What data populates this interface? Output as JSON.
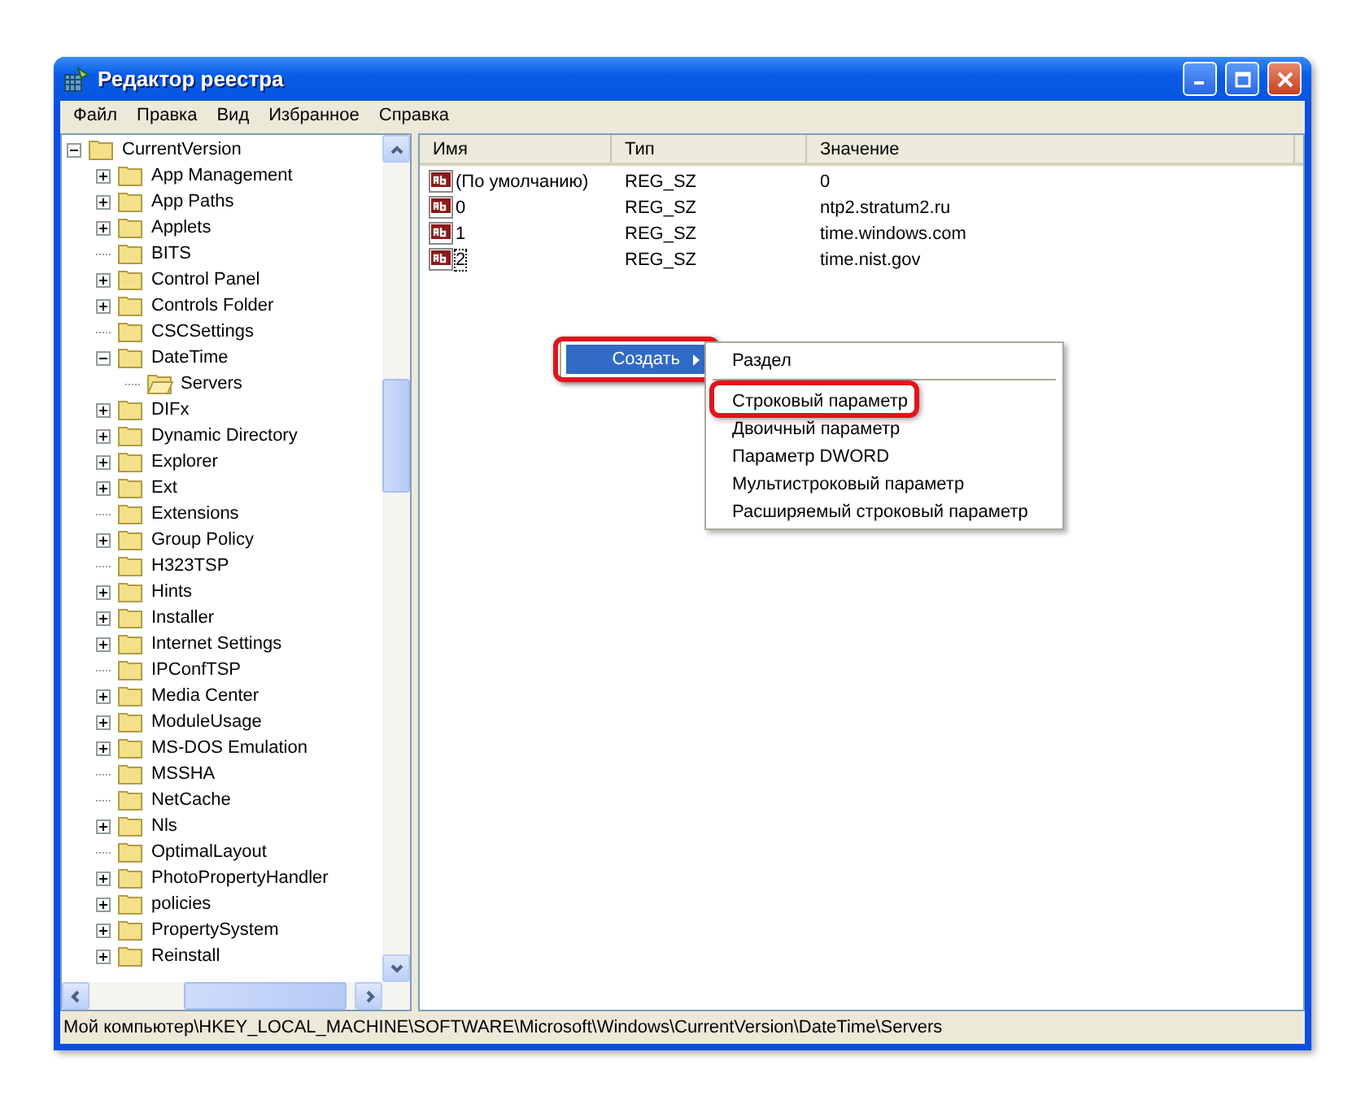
{
  "window": {
    "title": "Редактор реестра"
  },
  "menu_bar": [
    "Файл",
    "Правка",
    "Вид",
    "Избранное",
    "Справка"
  ],
  "tree": [
    {
      "label": "CurrentVersion",
      "kind": "node",
      "expanded": true,
      "selected": false,
      "children": [
        {
          "label": "App Management",
          "kind": "node",
          "expanded": false,
          "selected": false
        },
        {
          "label": "App Paths",
          "kind": "node",
          "expanded": false,
          "selected": false
        },
        {
          "label": "Applets",
          "kind": "node",
          "expanded": false,
          "selected": false
        },
        {
          "label": "BITS",
          "kind": "leaf",
          "selected": false
        },
        {
          "label": "Control Panel",
          "kind": "node",
          "expanded": false,
          "selected": false
        },
        {
          "label": "Controls Folder",
          "kind": "node",
          "expanded": false,
          "selected": false
        },
        {
          "label": "CSCSettings",
          "kind": "leaf",
          "selected": false
        },
        {
          "label": "DateTime",
          "kind": "node",
          "expanded": true,
          "selected": false,
          "children": [
            {
              "label": "Servers",
              "kind": "leaf",
              "selected": true
            }
          ]
        },
        {
          "label": "DIFx",
          "kind": "node",
          "expanded": false,
          "selected": false
        },
        {
          "label": "Dynamic Directory",
          "kind": "node",
          "expanded": false,
          "selected": false
        },
        {
          "label": "Explorer",
          "kind": "node",
          "expanded": false,
          "selected": false
        },
        {
          "label": "Ext",
          "kind": "node",
          "expanded": false,
          "selected": false
        },
        {
          "label": "Extensions",
          "kind": "leaf",
          "selected": false
        },
        {
          "label": "Group Policy",
          "kind": "node",
          "expanded": false,
          "selected": false
        },
        {
          "label": "H323TSP",
          "kind": "leaf",
          "selected": false
        },
        {
          "label": "Hints",
          "kind": "node",
          "expanded": false,
          "selected": false
        },
        {
          "label": "Installer",
          "kind": "node",
          "expanded": false,
          "selected": false
        },
        {
          "label": "Internet Settings",
          "kind": "node",
          "expanded": false,
          "selected": false
        },
        {
          "label": "IPConfTSP",
          "kind": "leaf",
          "selected": false
        },
        {
          "label": "Media Center",
          "kind": "node",
          "expanded": false,
          "selected": false
        },
        {
          "label": "ModuleUsage",
          "kind": "node",
          "expanded": false,
          "selected": false
        },
        {
          "label": "MS-DOS Emulation",
          "kind": "node",
          "expanded": false,
          "selected": false
        },
        {
          "label": "MSSHA",
          "kind": "leaf",
          "selected": false
        },
        {
          "label": "NetCache",
          "kind": "leaf",
          "selected": false
        },
        {
          "label": "Nls",
          "kind": "node",
          "expanded": false,
          "selected": false
        },
        {
          "label": "OptimalLayout",
          "kind": "leaf",
          "selected": false
        },
        {
          "label": "PhotoPropertyHandler",
          "kind": "node",
          "expanded": false,
          "selected": false
        },
        {
          "label": "policies",
          "kind": "node",
          "expanded": false,
          "selected": false
        },
        {
          "label": "PropertySystem",
          "kind": "node",
          "expanded": false,
          "selected": false
        },
        {
          "label": "Reinstall",
          "kind": "node",
          "expanded": false,
          "selected": false
        }
      ]
    }
  ],
  "table": {
    "columns": [
      "Имя",
      "Тип",
      "Значение"
    ],
    "rows": [
      {
        "name": "(По умолчанию)",
        "type": "REG_SZ",
        "value": "0",
        "focused": false
      },
      {
        "name": "0",
        "type": "REG_SZ",
        "value": "ntp2.stratum2.ru",
        "focused": false
      },
      {
        "name": "1",
        "type": "REG_SZ",
        "value": "time.windows.com",
        "focused": false
      },
      {
        "name": "2",
        "type": "REG_SZ",
        "value": "time.nist.gov",
        "focused": true
      }
    ]
  },
  "context_menu": {
    "items": [
      {
        "label": "Создать",
        "selected": true,
        "annotated": true
      }
    ]
  },
  "submenu": {
    "items": [
      {
        "kind": "item",
        "label": "Раздел",
        "annotated": false
      },
      {
        "kind": "separator"
      },
      {
        "kind": "item",
        "label": "Строковый параметр",
        "annotated": true
      },
      {
        "kind": "item",
        "label": "Двоичный параметр",
        "annotated": false
      },
      {
        "kind": "item",
        "label": "Параметр DWORD",
        "annotated": false
      },
      {
        "kind": "item",
        "label": "Мультистроковый параметр",
        "annotated": false
      },
      {
        "kind": "item",
        "label": "Расширяемый строковый параметр",
        "annotated": false
      }
    ]
  },
  "status_bar": "Мой компьютер\\HKEY_LOCAL_MACHINE\\SOFTWARE\\Microsoft\\Windows\\CurrentVersion\\DateTime\\Servers"
}
